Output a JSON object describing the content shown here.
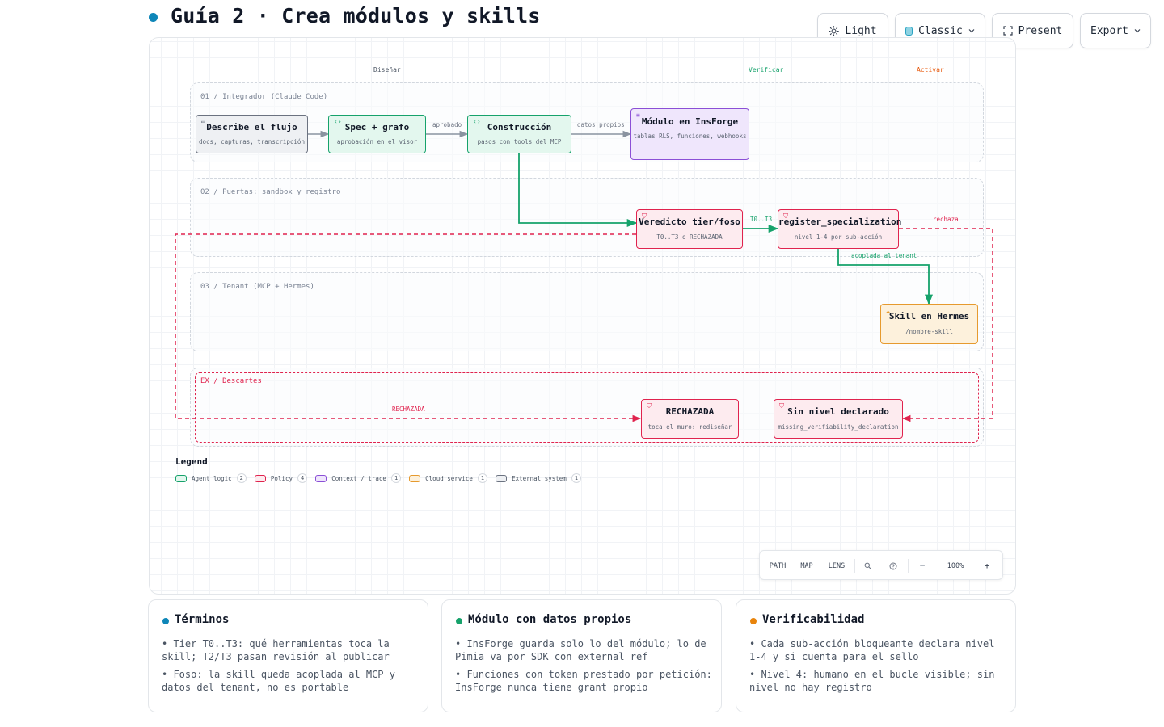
{
  "header": {
    "title": "Guía 2 · Crea módulos y skills",
    "buttons": {
      "light": "Light",
      "classic": "Classic",
      "present": "Present",
      "export": "Export"
    }
  },
  "diagram": {
    "phases": {
      "design": "Diseñar",
      "verify": "Verificar",
      "activate": "Activar"
    },
    "lanes": {
      "integrator": "01 / Integrador (Claude Code)",
      "gates": "02 / Puertas: sandbox y registro",
      "tenant": "03 / Tenant (MCP + Hermes)",
      "discards": "EX / Descartes"
    },
    "nodes": {
      "describe": {
        "title": "Describe el flujo",
        "sub": "docs, capturas, transcripción"
      },
      "spec": {
        "title": "Spec + grafo",
        "sub": "aprobación en el visor"
      },
      "build": {
        "title": "Construcción",
        "sub": "pasos con tools del MCP"
      },
      "module": {
        "title": "Módulo en InsForge",
        "sub": "tablas RLS, funciones, webhooks"
      },
      "verdict": {
        "title": "Veredicto tier/foso",
        "sub": "T0..T3 o RECHAZADA"
      },
      "register": {
        "title": "register_specialization",
        "sub": "nivel 1-4 por sub-acción"
      },
      "skill": {
        "title": "Skill en Hermes",
        "sub": "/nombre-skill"
      },
      "rejected": {
        "title": "RECHAZADA",
        "sub": "toca el muro: rediseñar"
      },
      "nolevel": {
        "title": "Sin nivel declarado",
        "sub": "missing_verifiability_declaration"
      }
    },
    "edges": {
      "approved": "aprobado",
      "own_data": "datos propios",
      "t0t3": "T0..T3",
      "coupled": "acoplada al tenant",
      "rejects": "rechaza",
      "rejected": "RECHAZADA"
    },
    "colors": {
      "agent": "#16a26b",
      "policy": "#e0234e",
      "context": "#8b4fd6",
      "cloud": "#e69a2e",
      "external": "#6b7280",
      "phase_verify": "#16a26b",
      "phase_activate": "#e8590c"
    }
  },
  "legend": {
    "title": "Legend",
    "items": [
      {
        "label": "Agent logic",
        "count": "2"
      },
      {
        "label": "Policy",
        "count": "4"
      },
      {
        "label": "Context / trace",
        "count": "1"
      },
      {
        "label": "Cloud service",
        "count": "1"
      },
      {
        "label": "External system",
        "count": "1"
      }
    ]
  },
  "zoom": {
    "path": "PATH",
    "map": "MAP",
    "lens": "LENS",
    "minus": "−",
    "level": "100%",
    "plus": "+"
  },
  "cards": [
    {
      "title": "Términos",
      "color": "#0e86b8",
      "items": [
        "• Tier T0..T3: qué herramientas toca la skill; T2/T3 pasan revisión al publicar",
        "• Foso: la skill queda acoplada al MCP y datos del tenant, no es portable"
      ]
    },
    {
      "title": "Módulo con datos propios",
      "color": "#16a26b",
      "items": [
        "• InsForge guarda solo lo del módulo; lo de Pimia va por SDK con external_ref",
        "• Funciones con token prestado por petición: InsForge nunca tiene grant propio"
      ]
    },
    {
      "title": "Verificabilidad",
      "color": "#e8840c",
      "items": [
        "• Cada sub-acción bloqueante declara nivel 1-4 y si cuenta para el sello",
        "• Nivel 4: humano en el bucle visible; sin nivel no hay registro"
      ]
    }
  ]
}
